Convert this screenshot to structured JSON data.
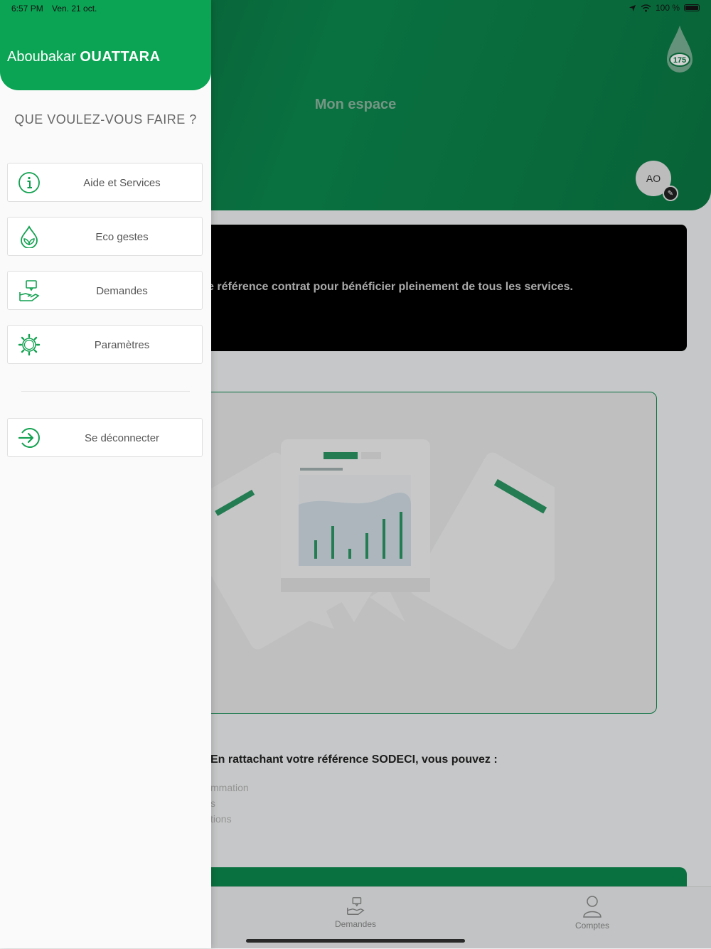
{
  "status_bar": {
    "time": "6:57 PM",
    "date": "Ven. 21 oct.",
    "battery": "100 %"
  },
  "app": {
    "title": "Mon espace",
    "logo_text": "175",
    "avatar_initials": "AO",
    "banner_text": "e référence contrat pour bénéficier pleinement de tous les services.",
    "benefits_title": "En rattachant votre référence SODECI, vous pouvez :",
    "benefits": [
      "mmation",
      "s",
      "tions"
    ],
    "tabs": [
      {
        "label": "Demandes",
        "icon": "hand-message-icon"
      },
      {
        "label": "Comptes",
        "icon": "person-icon"
      }
    ]
  },
  "drawer": {
    "user_first_name": "Aboubakar",
    "user_last_name": "OUATTARA",
    "heading": "QUE VOULEZ-VOUS FAIRE ?",
    "items": [
      {
        "label": "Aide et Services",
        "icon": "info-icon"
      },
      {
        "label": "Eco gestes",
        "icon": "eco-drop-icon"
      },
      {
        "label": "Demandes",
        "icon": "hand-message-icon"
      },
      {
        "label": "Paramètres",
        "icon": "gear-icon"
      }
    ],
    "logout_label": "Se déconnecter",
    "logout_icon": "logout-icon"
  },
  "colors": {
    "brand_green": "#0ba454",
    "header_green": "#0c8a4f",
    "icon_green": "#12a150"
  }
}
